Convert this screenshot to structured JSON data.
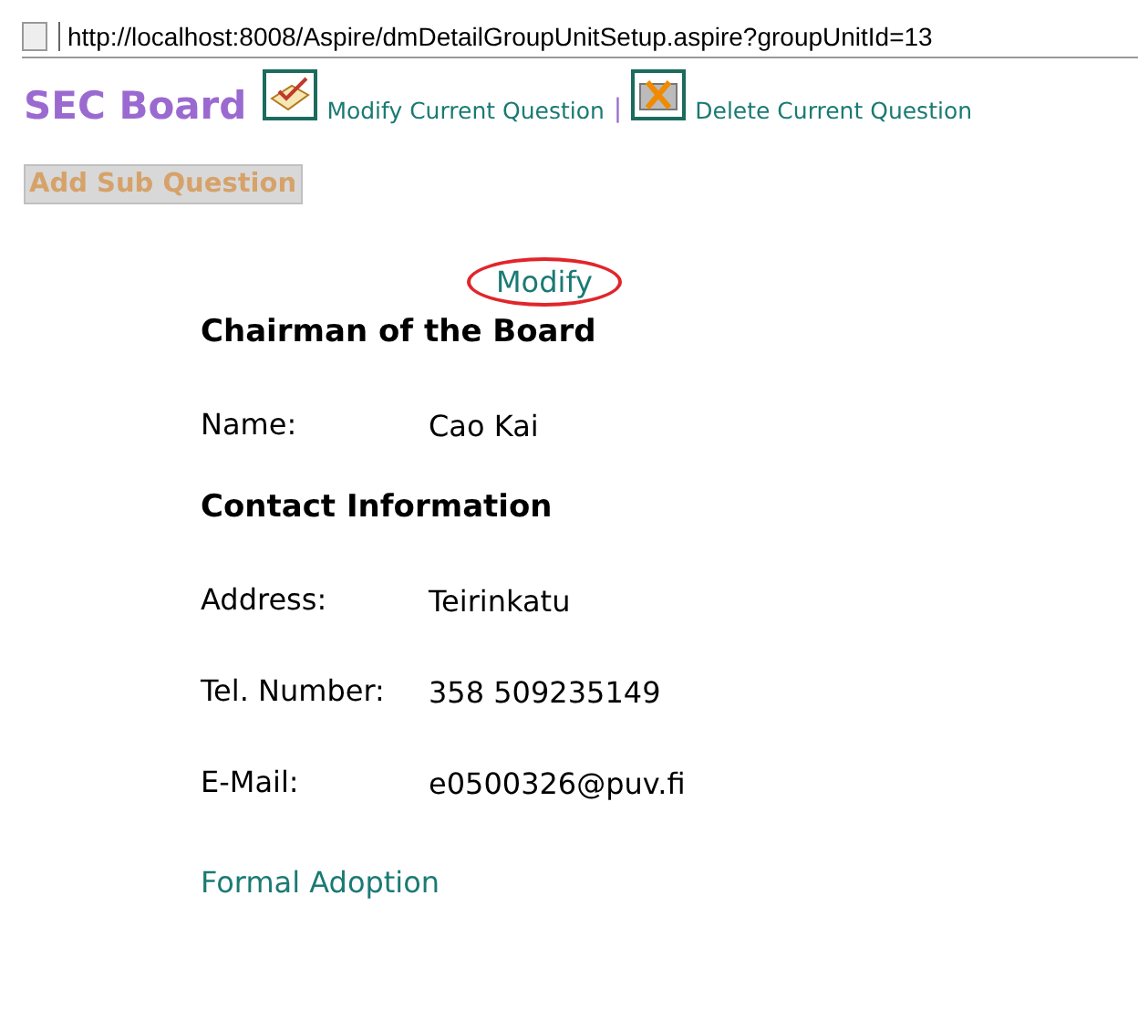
{
  "address_bar": {
    "url": "http://localhost:8008/Aspire/dmDetailGroupUnitSetup.aspire?groupUnitId=13"
  },
  "header": {
    "title": "SEC Board",
    "links": [
      {
        "label": "Modify Current Question",
        "kind": "modify"
      },
      {
        "label": "Delete Current Question",
        "kind": "delete"
      }
    ],
    "separator": "|"
  },
  "add_button": {
    "label": "Add Sub Question",
    "disabled": true
  },
  "modify_link": {
    "label": "Modify",
    "highlighted": true
  },
  "sections": [
    {
      "heading": "Chairman of the Board",
      "fields": [
        {
          "label": "Name:",
          "value": "Cao Kai"
        }
      ]
    },
    {
      "heading": "Contact Information",
      "fields": [
        {
          "label": "Address:",
          "value": "Teirinkatu"
        },
        {
          "label": "Tel. Number:",
          "value": "358 509235149"
        },
        {
          "label": "E-Mail:",
          "value": "e0500326@puv.fi"
        }
      ]
    }
  ],
  "footer_link": {
    "label": "Formal Adoption"
  }
}
